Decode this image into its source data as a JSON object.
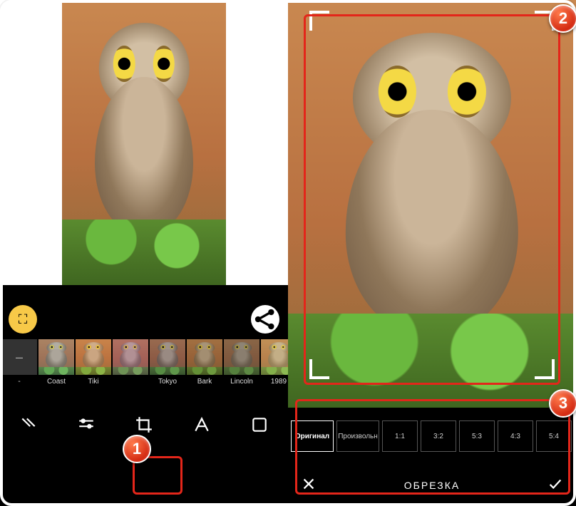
{
  "left": {
    "expand_icon": "⛶",
    "share_icon": "share",
    "filters": [
      {
        "label": "-"
      },
      {
        "label": "Coast"
      },
      {
        "label": "Tiki"
      },
      {
        "label": ""
      },
      {
        "label": "Tokyo"
      },
      {
        "label": "Bark"
      },
      {
        "label": "Lincoln"
      },
      {
        "label": "1989"
      }
    ],
    "tools": [
      "effects",
      "adjust",
      "crop",
      "text",
      "sticker"
    ]
  },
  "right": {
    "ratios": [
      {
        "label": "Оригинал",
        "selected": true
      },
      {
        "label": "Произвольн",
        "selected": false
      },
      {
        "label": "1:1",
        "selected": false
      },
      {
        "label": "3:2",
        "selected": false
      },
      {
        "label": "5:3",
        "selected": false
      },
      {
        "label": "4:3",
        "selected": false
      },
      {
        "label": "5:4",
        "selected": false
      }
    ],
    "title": "ОБРЕЗКА"
  },
  "callouts": {
    "one": "1",
    "two": "2",
    "three": "3"
  }
}
